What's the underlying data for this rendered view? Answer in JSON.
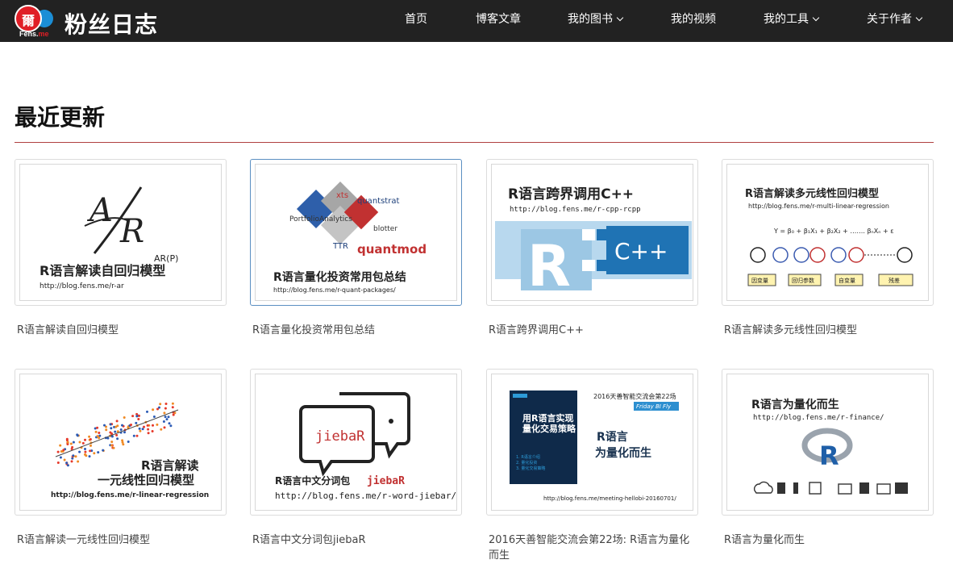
{
  "header": {
    "logo_glyph": "爾",
    "logo_text_a": "Fens.",
    "logo_text_b": "me",
    "brand": "粉丝日志",
    "nav": [
      {
        "label": "首页",
        "has_menu": false
      },
      {
        "label": "博客文章",
        "has_menu": false
      },
      {
        "label": "我的图书",
        "has_menu": true
      },
      {
        "label": "我的视频",
        "has_menu": false
      },
      {
        "label": "我的工具",
        "has_menu": true
      },
      {
        "label": "关于作者",
        "has_menu": true
      }
    ]
  },
  "section": {
    "title": "最近更新"
  },
  "posts": [
    {
      "caption": "R语言解读自回归模型",
      "thumb": {
        "headline": "R语言解读自回归模型",
        "url": "http://blog.fens.me/r-ar",
        "label": "AR(P)",
        "letter_a": "A",
        "letter_r": "R"
      }
    },
    {
      "caption": "R语言量化投资常用包总结",
      "thumb": {
        "headline": "R语言量化投资常用包总结",
        "url": "http://blog.fens.me/r-quant-packages/",
        "pkg_xts": "xts",
        "pkg_quantstrat": "quantstrat",
        "pkg_pa": "PortfolioAnalytics",
        "pkg_blotter": "blotter",
        "pkg_ttr": "TTR",
        "pkg_quantmod": "quantmod"
      }
    },
    {
      "caption": "R语言跨界调用C++",
      "thumb": {
        "headline": "R语言跨界调用C++",
        "url": "http://blog.fens.me/r-cpp-rcpp",
        "r_letter": "R",
        "cpp": "C++"
      }
    },
    {
      "caption": "R语言解读多元线性回归模型",
      "thumb": {
        "headline": "R语言解读多元线性回归模型",
        "url": "http://blog.fens.me/r-multi-linear-regression",
        "formula": "Y = β₀ + β₁X₁ + β₂X₂ + ……. βₙXₙ + ε",
        "labels": [
          "因变量",
          "回归参数",
          "自变量",
          "残差"
        ]
      }
    },
    {
      "caption": "R语言解读一元线性回归模型",
      "thumb": {
        "headline_1": "R语言解读",
        "headline_2": "一元线性回归模型",
        "url": "http://blog.fens.me/r-linear-regression"
      }
    },
    {
      "caption": "R语言中文分词包jiebaR",
      "thumb": {
        "headline_a": "R语言中文分词包",
        "headline_b": "jiebaR",
        "url": "http://blog.fens.me/r-word-jiebar/",
        "bubble_text": "jiebaR"
      }
    },
    {
      "caption": "2016天善智能交流会第22场: R语言为量化而生",
      "thumb": {
        "event": "2016天善智能交流会第22场",
        "tag": "Friday BI Fly",
        "poster_title_1": "用R语言实现",
        "poster_title_2": "量化交易策略",
        "headline_1": "R语言",
        "headline_2": "为量化而生",
        "url": "http://blog.fens.me/meeting-hellobi-20160701/",
        "list": [
          "1. R语言介绍",
          "2. 量化投资",
          "3. 量化交易策略"
        ]
      }
    },
    {
      "caption": "R语言为量化而生",
      "thumb": {
        "headline": "R语言为量化而生",
        "url": "http://blog.fens.me/r-finance/",
        "r_letter": "R"
      }
    }
  ]
}
